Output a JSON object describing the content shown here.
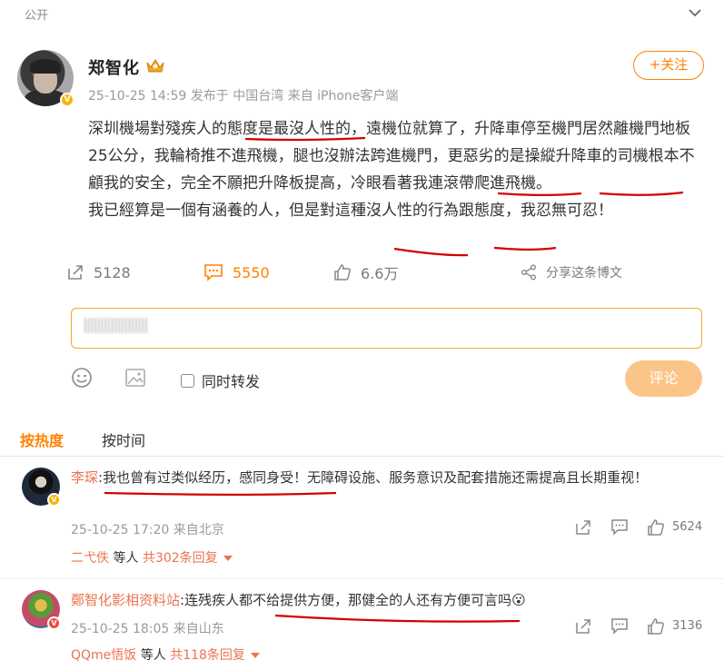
{
  "header": {
    "visibility": "公开"
  },
  "post": {
    "author": "郑智化",
    "timestamp": "25-10-25 14:59",
    "location": "发布于 中国台湾",
    "source": "来自 iPhone客户端",
    "follow_label": "+关注",
    "text_1": "深圳機場對殘疾人的態度是最沒人性的，遠機位就算了，升降車停至機門居然離機門地板25公分，我輪椅推不進飛機，腿也沒辦法跨進機門，更惡劣的是操縱升降車的司機根本不顧我的安全，完全不願把升降板提高，冷眼看著我連滾帶爬進飛機。",
    "text_2": "我已經算是一個有涵養的人，但是對這種沒人性的行為跟態度，我忍無可忍！"
  },
  "actions": {
    "repost_count": "5128",
    "comment_count": "5550",
    "like_count": "6.6万",
    "share_label": "分享这条博文"
  },
  "composer": {
    "draft_text": "|||||||||||||||||||",
    "repost_label": "同时转发",
    "submit_label": "评论"
  },
  "sort_tabs": {
    "hot": "按热度",
    "time": "按时间"
  },
  "comments": [
    {
      "name": "李琛",
      "text": ":我也曾有过类似经历，感同身受！无障碍设施、服务意识及配套措施还需提高且长期重视！",
      "time": "25-10-25 17:20 来自北京",
      "likes": "5624",
      "reply_names": "二弋佚",
      "reply_mid": " 等人 ",
      "reply_count": "共302条回复"
    },
    {
      "name": "鄭智化影相资料站",
      "text": ":连残疾人都不给提供方便，那健全的人还有方便可言吗",
      "emoji": "😮",
      "time": "25-10-25 18:05 来自山东",
      "likes": "3136",
      "reply_names": "QQme悟饭",
      "reply_mid": " 等人 ",
      "reply_count": "共118条回复"
    }
  ],
  "colors": {
    "accent": "#ff8200",
    "link": "#eb7350",
    "annotation": "#d40000"
  }
}
